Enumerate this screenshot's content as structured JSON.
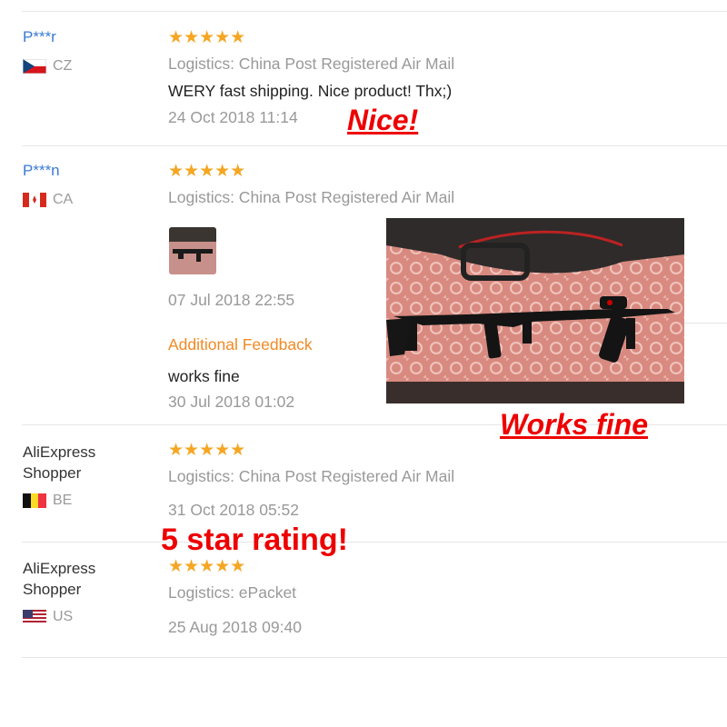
{
  "reviews": [
    {
      "name": "P***r",
      "country": "CZ",
      "stars": "★★★★★",
      "logistics": "Logistics: China Post Registered Air Mail",
      "text": "WERY fast shipping. Nice product! Thx;)",
      "date": "24 Oct 2018 11:14",
      "annotation": "Nice!"
    },
    {
      "name": "P***n",
      "country": "CA",
      "stars": "★★★★★",
      "logistics": "Logistics: China Post Registered Air Mail",
      "date": "07 Jul 2018 22:55",
      "additional_feedback_label": "Additional Feedback",
      "additional_text": "works fine",
      "additional_date": "30 Jul 2018 01:02",
      "annotation": "Works fine"
    },
    {
      "name": "AliExpress Shopper",
      "country": "BE",
      "stars": "★★★★★",
      "logistics": "Logistics: China Post Registered Air Mail",
      "date": "31 Oct 2018 05:52",
      "annotation": "5 star rating!"
    },
    {
      "name": "AliExpress Shopper",
      "country": "US",
      "stars": "★★★★★",
      "logistics": "Logistics: ePacket",
      "date": "25 Aug 2018 09:40"
    }
  ],
  "colors": {
    "star": "#f5a623",
    "username": "#3a7bd5",
    "additional_feedback": "#f08a24",
    "annotation": "#ee0000"
  },
  "icons": [
    "star-icon",
    "flag-cz-icon",
    "flag-ca-icon",
    "flag-be-icon",
    "flag-us-icon"
  ]
}
